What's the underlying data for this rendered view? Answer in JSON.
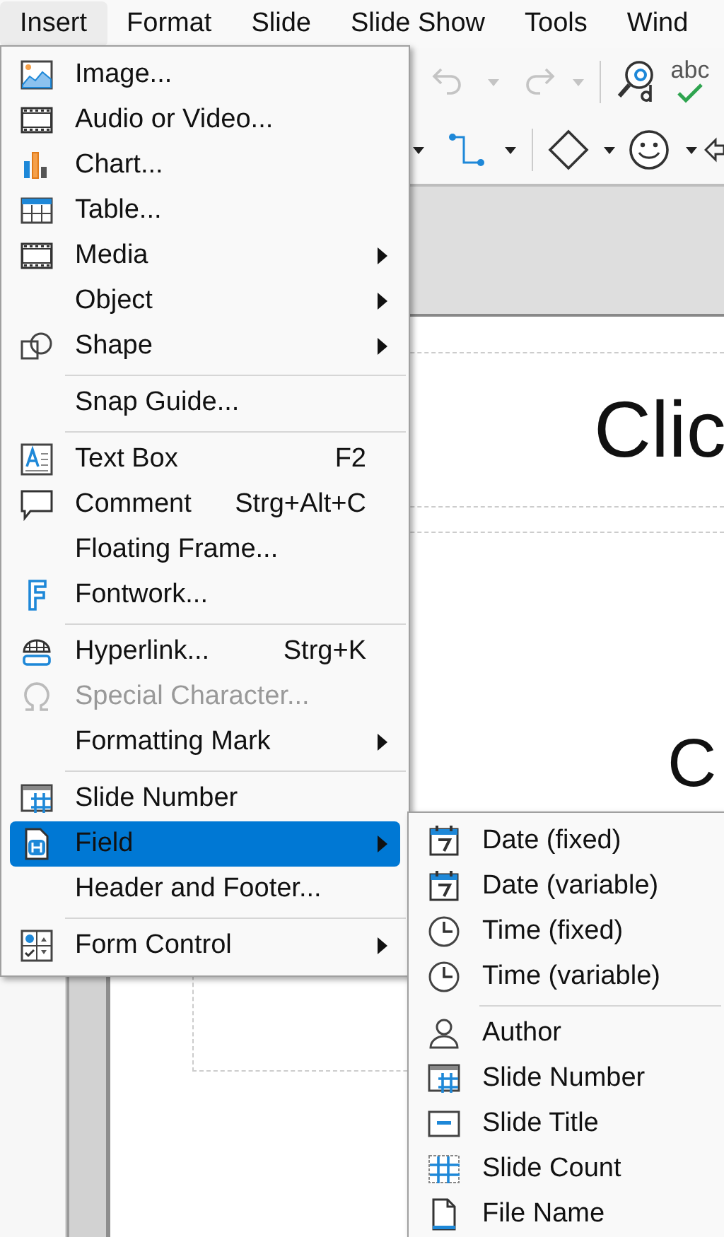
{
  "menubar": [
    {
      "label": "Insert",
      "selected": true
    },
    {
      "label": "Format",
      "selected": false
    },
    {
      "label": "Slide",
      "selected": false
    },
    {
      "label": "Slide Show",
      "selected": false
    },
    {
      "label": "Tools",
      "selected": false
    },
    {
      "label": "Wind",
      "selected": false
    }
  ],
  "toolbar": {
    "undo_disabled": true,
    "redo_disabled": true,
    "spelling_label": "abc"
  },
  "slide": {
    "title_text": "Clic",
    "body_text": "C"
  },
  "insert_menu": {
    "items": [
      {
        "kind": "item",
        "label": "Image...",
        "submenu": false,
        "disabled": false,
        "selected": false
      },
      {
        "kind": "item",
        "label": "Audio or Video...",
        "submenu": false,
        "disabled": false,
        "selected": false
      },
      {
        "kind": "item",
        "label": "Chart...",
        "submenu": false,
        "disabled": false,
        "selected": false
      },
      {
        "kind": "item",
        "label": "Table...",
        "submenu": false,
        "disabled": false,
        "selected": false
      },
      {
        "kind": "item",
        "label": "Media",
        "submenu": true,
        "disabled": false,
        "selected": false
      },
      {
        "kind": "item",
        "label": "Object",
        "submenu": true,
        "disabled": false,
        "selected": false
      },
      {
        "kind": "item",
        "label": "Shape",
        "submenu": true,
        "disabled": false,
        "selected": false
      },
      {
        "kind": "separator"
      },
      {
        "kind": "item",
        "label": "Snap Guide...",
        "submenu": false,
        "disabled": false,
        "selected": false
      },
      {
        "kind": "separator"
      },
      {
        "kind": "item",
        "label": "Text Box",
        "shortcut": "F2",
        "submenu": false,
        "disabled": false,
        "selected": false
      },
      {
        "kind": "item",
        "label": "Comment",
        "shortcut": "Strg+Alt+C",
        "submenu": false,
        "disabled": false,
        "selected": false
      },
      {
        "kind": "item",
        "label": "Floating Frame...",
        "submenu": false,
        "disabled": false,
        "selected": false
      },
      {
        "kind": "item",
        "label": "Fontwork...",
        "submenu": false,
        "disabled": false,
        "selected": false
      },
      {
        "kind": "separator"
      },
      {
        "kind": "item",
        "label": "Hyperlink...",
        "shortcut": "Strg+K",
        "submenu": false,
        "disabled": false,
        "selected": false
      },
      {
        "kind": "item",
        "label": "Special Character...",
        "submenu": false,
        "disabled": true,
        "selected": false
      },
      {
        "kind": "item",
        "label": "Formatting Mark",
        "submenu": true,
        "disabled": false,
        "selected": false
      },
      {
        "kind": "separator"
      },
      {
        "kind": "item",
        "label": "Slide Number",
        "submenu": false,
        "disabled": false,
        "selected": false
      },
      {
        "kind": "item",
        "label": "Field",
        "submenu": true,
        "disabled": false,
        "selected": true
      },
      {
        "kind": "item",
        "label": "Header and Footer...",
        "submenu": false,
        "disabled": false,
        "selected": false
      },
      {
        "kind": "separator"
      },
      {
        "kind": "item",
        "label": "Form Control",
        "submenu": true,
        "disabled": false,
        "selected": false
      }
    ]
  },
  "field_submenu": {
    "items": [
      {
        "kind": "item",
        "label": "Date (fixed)",
        "submenu": false,
        "disabled": false,
        "selected": false
      },
      {
        "kind": "item",
        "label": "Date (variable)",
        "submenu": false,
        "disabled": false,
        "selected": false
      },
      {
        "kind": "item",
        "label": "Time (fixed)",
        "submenu": false,
        "disabled": false,
        "selected": false
      },
      {
        "kind": "item",
        "label": "Time (variable)",
        "submenu": false,
        "disabled": false,
        "selected": false
      },
      {
        "kind": "separator"
      },
      {
        "kind": "item",
        "label": "Author",
        "submenu": false,
        "disabled": false,
        "selected": false
      },
      {
        "kind": "item",
        "label": "Slide Number",
        "submenu": false,
        "disabled": false,
        "selected": false
      },
      {
        "kind": "item",
        "label": "Slide Title",
        "submenu": false,
        "disabled": false,
        "selected": false
      },
      {
        "kind": "item",
        "label": "Slide Count",
        "submenu": false,
        "disabled": false,
        "selected": false
      },
      {
        "kind": "item",
        "label": "File Name",
        "submenu": false,
        "disabled": false,
        "selected": false
      }
    ]
  }
}
